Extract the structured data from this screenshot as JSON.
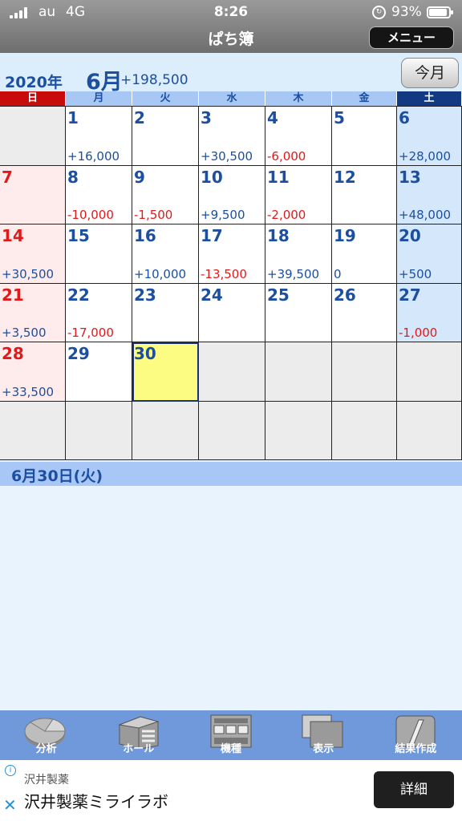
{
  "status_bar": {
    "carrier": "au",
    "network": "4G",
    "time": "8:26",
    "battery": "93%",
    "battery_level": 0.93
  },
  "app": {
    "title": "ぱち簿",
    "menu_label": "メニュー"
  },
  "calendar": {
    "year_label": "2020年",
    "month_label": "6月",
    "month_total": "+198,500",
    "today_button": "今月",
    "weekdays": [
      "日",
      "月",
      "火",
      "水",
      "木",
      "金",
      "土"
    ],
    "weeks": [
      [
        {
          "day": "",
          "amount": ""
        },
        {
          "day": "1",
          "amount": "+16,000"
        },
        {
          "day": "2",
          "amount": ""
        },
        {
          "day": "3",
          "amount": "+30,500"
        },
        {
          "day": "4",
          "amount": "-6,000"
        },
        {
          "day": "5",
          "amount": ""
        },
        {
          "day": "6",
          "amount": "+28,000"
        }
      ],
      [
        {
          "day": "7",
          "amount": ""
        },
        {
          "day": "8",
          "amount": "-10,000"
        },
        {
          "day": "9",
          "amount": "-1,500"
        },
        {
          "day": "10",
          "amount": "+9,500"
        },
        {
          "day": "11",
          "amount": "-2,000"
        },
        {
          "day": "12",
          "amount": ""
        },
        {
          "day": "13",
          "amount": "+48,000"
        }
      ],
      [
        {
          "day": "14",
          "amount": "+30,500"
        },
        {
          "day": "15",
          "amount": ""
        },
        {
          "day": "16",
          "amount": "+10,000"
        },
        {
          "day": "17",
          "amount": "-13,500"
        },
        {
          "day": "18",
          "amount": "+39,500"
        },
        {
          "day": "19",
          "amount": "0"
        },
        {
          "day": "20",
          "amount": "+500"
        }
      ],
      [
        {
          "day": "21",
          "amount": "+3,500"
        },
        {
          "day": "22",
          "amount": "-17,000"
        },
        {
          "day": "23",
          "amount": ""
        },
        {
          "day": "24",
          "amount": ""
        },
        {
          "day": "25",
          "amount": ""
        },
        {
          "day": "26",
          "amount": ""
        },
        {
          "day": "27",
          "amount": "-1,000"
        }
      ],
      [
        {
          "day": "28",
          "amount": "+33,500"
        },
        {
          "day": "29",
          "amount": ""
        },
        {
          "day": "30",
          "amount": "",
          "today": true
        },
        {
          "day": "",
          "amount": ""
        },
        {
          "day": "",
          "amount": ""
        },
        {
          "day": "",
          "amount": ""
        },
        {
          "day": "",
          "amount": ""
        }
      ],
      [
        {
          "day": "",
          "amount": ""
        },
        {
          "day": "",
          "amount": ""
        },
        {
          "day": "",
          "amount": ""
        },
        {
          "day": "",
          "amount": ""
        },
        {
          "day": "",
          "amount": ""
        },
        {
          "day": "",
          "amount": ""
        },
        {
          "day": "",
          "amount": ""
        }
      ]
    ]
  },
  "selected_date": "6月30日(火)",
  "toolbar": [
    {
      "label": "分析",
      "icon": "pie-chart-icon"
    },
    {
      "label": "ホール",
      "icon": "building-icon"
    },
    {
      "label": "機種",
      "icon": "slot-machine-icon"
    },
    {
      "label": "表示",
      "icon": "display-icon"
    },
    {
      "label": "結果作成",
      "icon": "edit-icon"
    }
  ],
  "ad": {
    "sponsor": "沢井製薬",
    "title": "沢井製薬ミライラボ",
    "button": "詳細"
  },
  "colors": {
    "accent": "#1d4fa1",
    "negative": "#e01a1a",
    "sunday": "#c70b0b",
    "saturday": "#123a82",
    "today": "#fcfc83",
    "toolbar": "#6f99db"
  }
}
